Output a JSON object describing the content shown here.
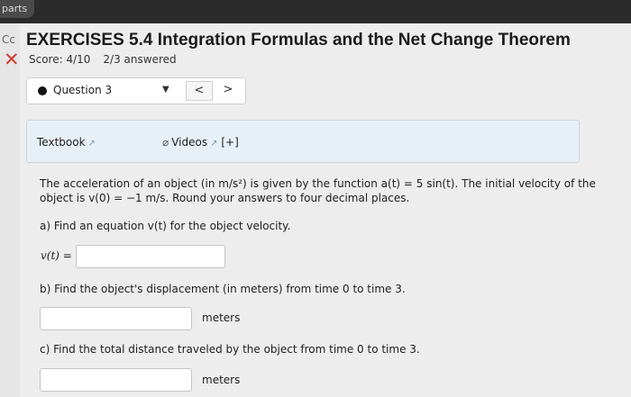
{
  "browser": {
    "tab_label": "parts"
  },
  "left": {
    "edge_text": "Cc",
    "close_symbol": "✕"
  },
  "header": {
    "title": "EXERCISES 5.4 Integration Formulas and the Net Change Theorem",
    "score": "Score: 4/10",
    "answered": "2/3 answered"
  },
  "question_nav": {
    "label": "Question 3",
    "caret": "▼",
    "prev": "<",
    "next": ">"
  },
  "resources": {
    "textbook": "Textbook",
    "videos": "Videos",
    "videos_expand": "[+]",
    "ext_icon": "external-link-icon",
    "clip_icon": "paperclip-icon"
  },
  "problem": {
    "line1": "The acceleration of an object (in m/s²) is given by the function a(t) = 5 sin(t). The initial velocity of the",
    "line2": "object is v(0) = −1 m/s. Round your answers to four decimal places.",
    "part_a": "a) Find an equation v(t) for the object velocity.",
    "v_label": "v(t) =",
    "v_value": "",
    "part_b": "b) Find the object's displacement (in meters) from time 0 to time 3.",
    "b_value": "",
    "b_unit": "meters",
    "part_c": "c) Find the total distance traveled by the object from time 0 to time 3.",
    "c_value": "",
    "c_unit": "meters"
  }
}
